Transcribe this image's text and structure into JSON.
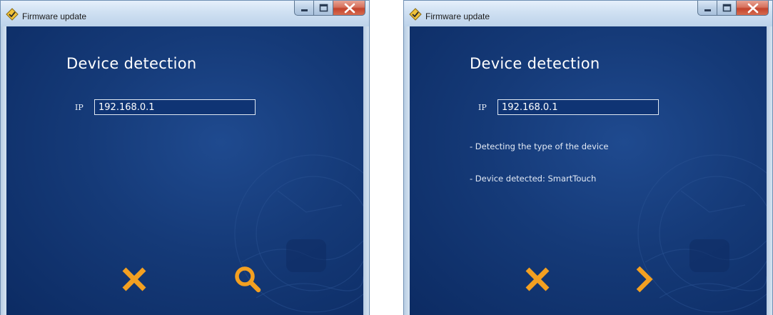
{
  "colors": {
    "accent_orange": "#f3a021",
    "panel_blue": "#153a78",
    "text_white": "#ffffff"
  },
  "windows": [
    {
      "title": "Firmware update",
      "title_icon": "diamond-check-icon",
      "heading": "Device detection",
      "ip_label": "IP",
      "ip_value": "192.168.0.1",
      "status_lines": [],
      "buttons": {
        "left_icon": "close-x-icon",
        "right_icon": "search-icon"
      }
    },
    {
      "title": "Firmware update",
      "title_icon": "diamond-check-icon",
      "heading": "Device detection",
      "ip_label": "IP",
      "ip_value": "192.168.0.1",
      "status_lines": [
        "- Detecting the type of the device",
        "- Device detected: SmartTouch"
      ],
      "buttons": {
        "left_icon": "close-x-icon",
        "right_icon": "chevron-right-icon"
      }
    }
  ]
}
